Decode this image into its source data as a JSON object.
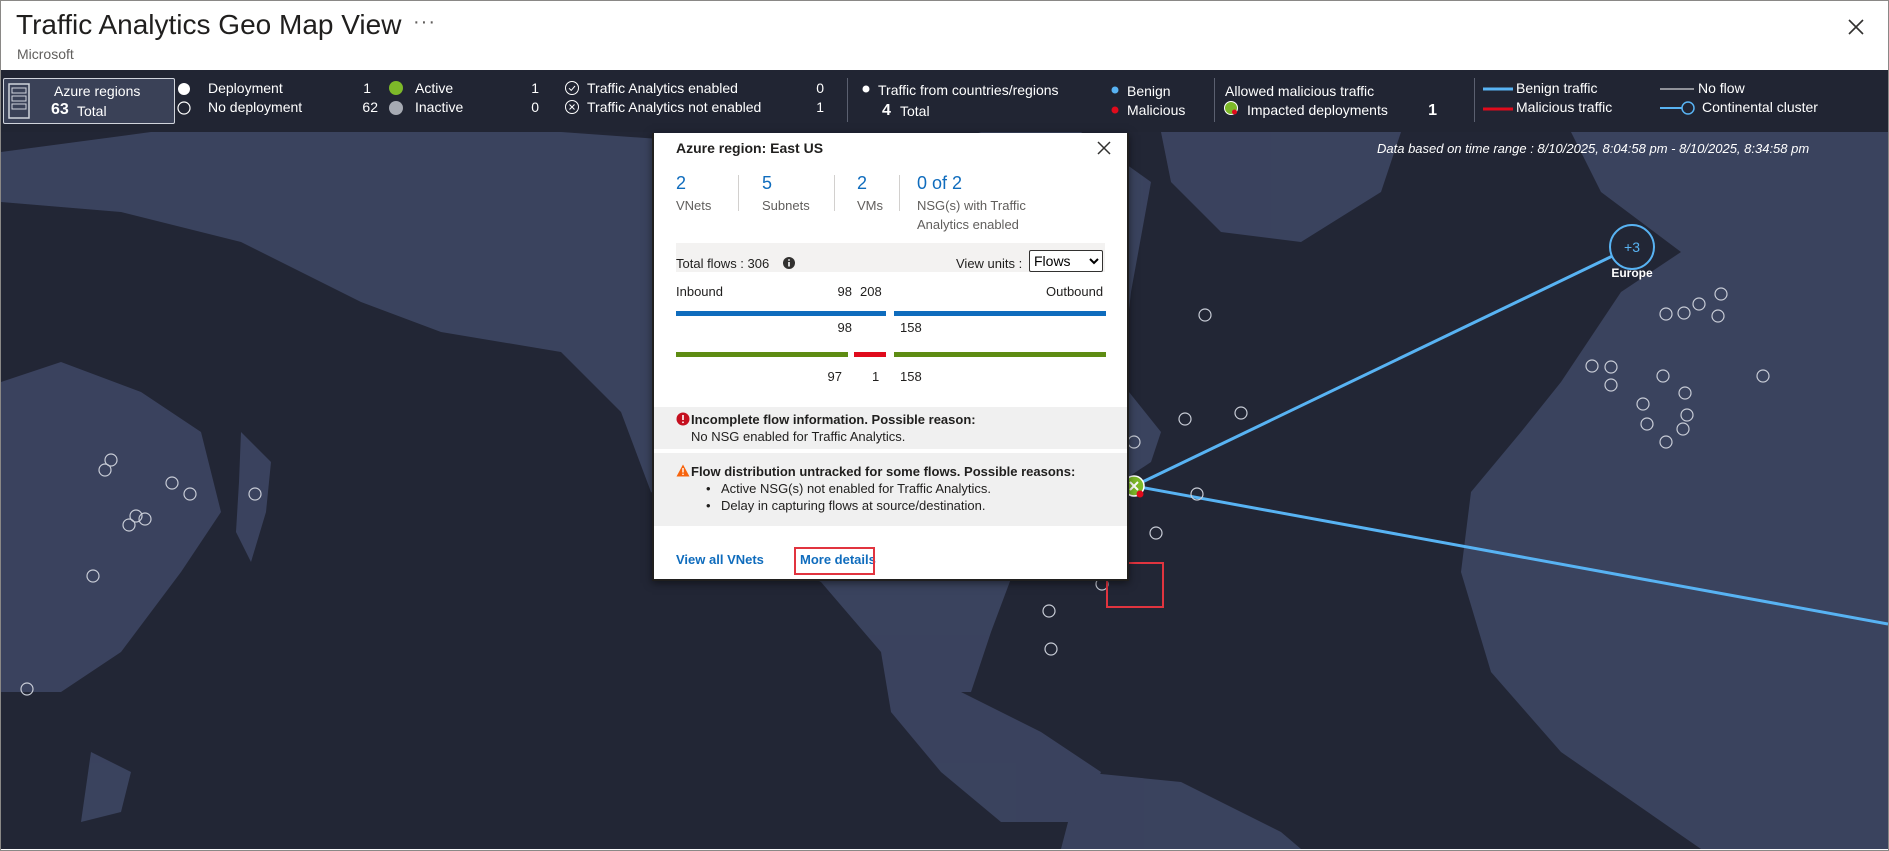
{
  "header": {
    "title": "Traffic Analytics Geo Map View",
    "subtitle": "Microsoft",
    "more_label": "···"
  },
  "legend": {
    "regions": {
      "label": "Azure regions",
      "count": "63",
      "total_label": "Total"
    },
    "deployment": [
      {
        "label": "Deployment",
        "value": "1"
      },
      {
        "label": "No deployment",
        "value": "62"
      }
    ],
    "activity": [
      {
        "label": "Active",
        "value": "1"
      },
      {
        "label": "Inactive",
        "value": "0"
      }
    ],
    "traffic_analytics": [
      {
        "label": "Traffic Analytics enabled",
        "value": "0"
      },
      {
        "label": "Traffic Analytics not enabled",
        "value": "1"
      }
    ],
    "countries": {
      "label": "Traffic from countries/regions",
      "count": "4",
      "total_label": "Total"
    },
    "benign_label": "Benign",
    "malicious_label": "Malicious",
    "allowed_malicious": {
      "title": "Allowed malicious traffic",
      "impacted_label": "Impacted deployments",
      "value": "1"
    },
    "lines": {
      "benign_traffic": "Benign traffic",
      "malicious_traffic": "Malicious traffic",
      "no_flow": "No flow",
      "continental_cluster": "Continental cluster"
    },
    "colors": {
      "benign": "#58b3f3",
      "malicious": "#e00b1c",
      "active": "#7db929",
      "inactive": "#a6aab3"
    }
  },
  "map": {
    "time_range": "Data based on time range : 8/10/2025, 8:04:58 pm - 8/10/2025, 8:34:58 pm",
    "cluster": {
      "count": "+3",
      "label": "Europe"
    }
  },
  "popup": {
    "title": "Azure region: East US",
    "stats": [
      {
        "value": "2",
        "label": "VNets"
      },
      {
        "value": "5",
        "label": "Subnets"
      },
      {
        "value": "2",
        "label": "VMs"
      },
      {
        "value": "0 of 2",
        "label": "NSG(s) with Traffic Analytics enabled"
      }
    ],
    "total_flows": "Total flows : 306",
    "view_units_label": "View units :",
    "view_units_value": "Flows",
    "inbound_label": "Inbound",
    "outbound_label": "Outbound",
    "inbound_total": "98",
    "outbound_total": "208",
    "inbound_benign_row": "98",
    "outbound_benign_row": "158",
    "inbound_allowed": "97",
    "inbound_malicious": "1",
    "outbound_allowed": "158",
    "incomplete": {
      "title": "Incomplete flow information. Possible reason:",
      "text": "No NSG enabled for Traffic Analytics."
    },
    "untracked": {
      "title": "Flow distribution untracked for some flows. Possible reasons:",
      "items": [
        "Active NSG(s) not enabled for Traffic Analytics.",
        "Delay in capturing flows at source/destination."
      ]
    },
    "view_all_link": "View all VNets",
    "more_details_link": "More details"
  }
}
